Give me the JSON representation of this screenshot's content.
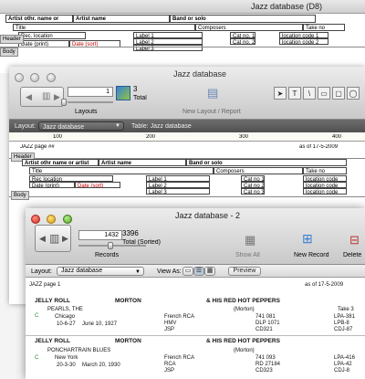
{
  "back_window": {
    "title": "Jazz database (D8)",
    "fields": {
      "artist_other": "Artist othr. name or ",
      "artist_name": "Artist name",
      "band_or_solo": "Band or solo",
      "title": "Title",
      "composers": "Composers",
      "take_no": "Take no",
      "rec_location": "Rec. location",
      "label1": "Label 1",
      "label2": "Label 2",
      "label3": "Label 3",
      "cat_no1": "Cat no. 1",
      "cat_no2": "Cat no. 2",
      "loc1": "location code 1",
      "loc2": "location code 2",
      "date_print": "Date (print)",
      "date_sort": "Date (sort)"
    },
    "tags": {
      "header": "Header",
      "body": "Body"
    }
  },
  "mid_window": {
    "title": "Jazz database",
    "record_number": "1",
    "total_count": "3",
    "total_label": "Total",
    "layouts_label": "Layouts",
    "new_layout_label": "New Layout / Report",
    "layout_label": "Layout:",
    "layout_value": "Jazz database",
    "table_label": "Table: Jazz database",
    "ruler_marks": [
      "100",
      "200",
      "300",
      "400"
    ],
    "page_text": "JAZZ page ##",
    "date_text": "as of 17-5-2009",
    "tags": {
      "header": "Header",
      "body": "Body"
    },
    "fields": {
      "artist_other": "Artist othr name or artist",
      "artist_name": "Artist name",
      "band_or_solo": "Band or solo",
      "title": "Title",
      "composers": "Composers",
      "take_no": "Take no",
      "rec_location": "Rec location",
      "date_print": "Date (print)",
      "date_sort": "Date (sort)",
      "label1": "Label 1",
      "label2": "Label 2",
      "label3": "Label 3",
      "cat_no1": "Cat no 1",
      "cat_no2": "Cat no 2",
      "cat_no3": "Cat no 3",
      "loc1": "location code",
      "loc2": "location code",
      "loc3": "location code"
    },
    "tools": [
      "T",
      "\\",
      "▭",
      "▢",
      "◯"
    ]
  },
  "front_window": {
    "title": "Jazz database - 2",
    "record_number": "1432",
    "total_count": "3396",
    "total_label": "Total (Sorted)",
    "records_label": "Records",
    "show_all_label": "Show All",
    "new_record_label": "New Record",
    "delete_label": "Delete",
    "layout_label": "Layout:",
    "layout_value": "Jazz database",
    "view_as_label": "View As:",
    "preview_label": "Preview",
    "page_text": "JAZZ page 1",
    "date_text": "as of 17-5-2009",
    "records": [
      {
        "artist_other": "JELLY ROLL",
        "artist_name": "MORTON",
        "band": "& HIS RED HOT PEPPERS",
        "marker": "C",
        "title": "PEARLS, THE",
        "composer": "(Morton)",
        "take": "Take 3",
        "location": "Chicago",
        "date_print": "10-6-27",
        "date_sort": "June 10, 1927",
        "labels": [
          "French RCA",
          "HMV",
          "JSP"
        ],
        "cat_nos": [
          "741 081",
          "DLP 1071",
          "CD321"
        ],
        "loc_codes": [
          "LPA-381",
          "LPB-8",
          "CDJ-87"
        ]
      },
      {
        "artist_other": "JELLY ROLL",
        "artist_name": "MORTON",
        "band": "& HIS RED HOT PEPPERS",
        "marker": "C",
        "title": "PONCHARTRAIN BLUES",
        "composer": "(Morton)",
        "take": "",
        "location": "New York",
        "date_print": "20-3-30",
        "date_sort": "March 20, 1930",
        "labels": [
          "French RCA",
          "RCA",
          "JSP"
        ],
        "cat_nos": [
          "741 093",
          "RD 27184",
          "CD323"
        ],
        "loc_codes": [
          "LPA-416",
          "LPA-42",
          "CDJ-8"
        ]
      }
    ]
  }
}
